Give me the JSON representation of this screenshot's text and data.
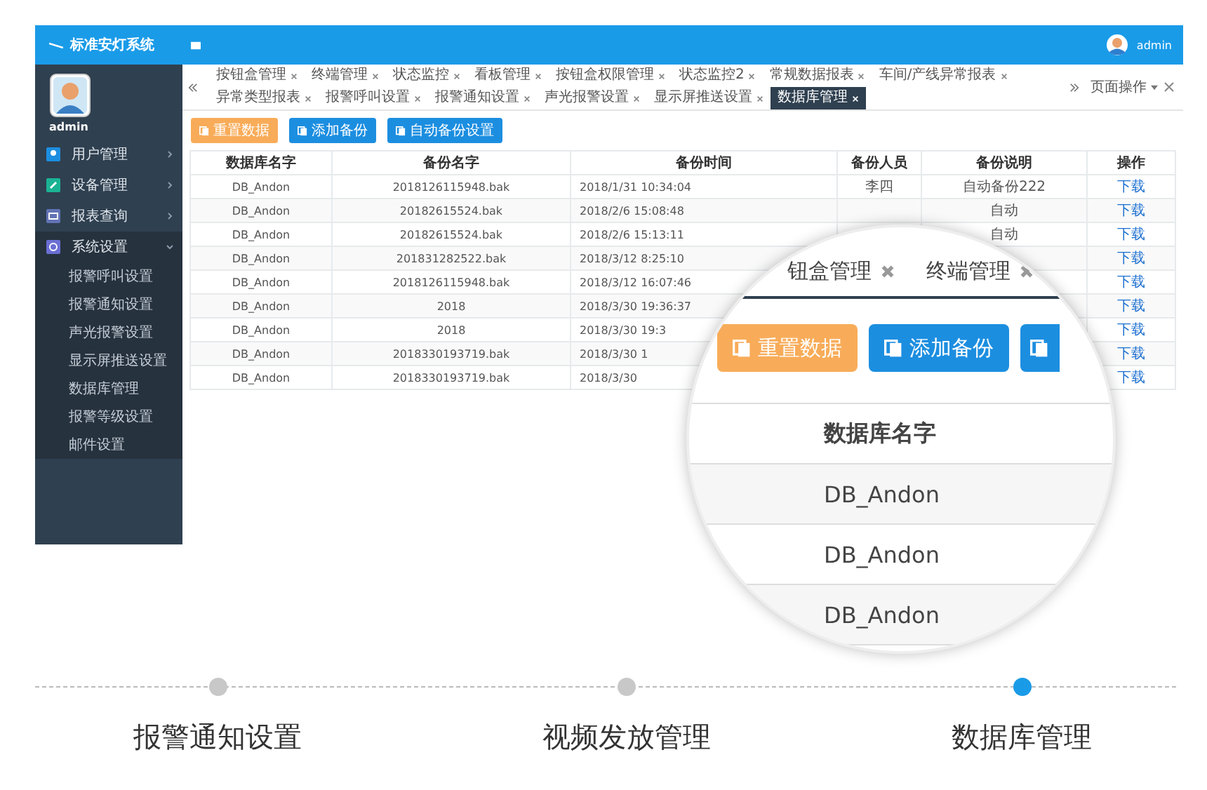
{
  "app": {
    "title": "标准安灯系统",
    "user": "admin",
    "sidebar": {
      "user": "admin",
      "items": [
        {
          "label": "用户管理",
          "expanded": false
        },
        {
          "label": "设备管理",
          "expanded": false
        },
        {
          "label": "报表查询",
          "expanded": false
        },
        {
          "label": "系统设置",
          "expanded": true,
          "children": [
            {
              "label": "报警呼叫设置"
            },
            {
              "label": "报警通知设置"
            },
            {
              "label": "声光报警设置"
            },
            {
              "label": "显示屏推送设置"
            },
            {
              "label": "数据库管理"
            },
            {
              "label": "报警等级设置"
            },
            {
              "label": "邮件设置"
            }
          ]
        }
      ]
    },
    "tabs": [
      {
        "label": "按钮盒管理",
        "selected": false
      },
      {
        "label": "终端管理",
        "selected": false
      },
      {
        "label": "状态监控",
        "selected": false
      },
      {
        "label": "看板管理",
        "selected": false
      },
      {
        "label": "按钮盒权限管理",
        "selected": false
      },
      {
        "label": "状态监控2",
        "selected": false
      },
      {
        "label": "常规数据报表",
        "selected": false
      },
      {
        "label": "车间/产线异常报表",
        "selected": false
      },
      {
        "label": "异常类型报表",
        "selected": false
      },
      {
        "label": "报警呼叫设置",
        "selected": false
      },
      {
        "label": "报警通知设置",
        "selected": false
      },
      {
        "label": "声光报警设置",
        "selected": false
      },
      {
        "label": "显示屏推送设置",
        "selected": false
      },
      {
        "label": "数据库管理",
        "selected": true
      }
    ],
    "tab_menu": "页面操作",
    "buttons": [
      {
        "label": "重置数据",
        "kind": "warning"
      },
      {
        "label": "添加备份",
        "kind": "primary"
      },
      {
        "label": "自动备份设置",
        "kind": "primary"
      }
    ],
    "table": {
      "columns": [
        "数据库名字",
        "备份名字",
        "备份时间",
        "备份人员",
        "备份说明",
        "操作"
      ],
      "rows": [
        {
          "db": "DB_Andon",
          "file": "2018126115948.bak",
          "time": "2018/1/31 10:34:04",
          "person": "李四",
          "note": "自动备份222",
          "action": "下载"
        },
        {
          "db": "DB_Andon",
          "file": "20182615524.bak",
          "time": "2018/2/6 15:08:48",
          "note": "自动",
          "action": "下载"
        },
        {
          "db": "DB_Andon",
          "file": "20182615524.bak",
          "time": "2018/2/6 15:13:11",
          "note": "自动",
          "action": "下载"
        },
        {
          "db": "DB_Andon",
          "file": "201831282522.bak",
          "time": "2018/3/12 8:25:10",
          "action": "下载"
        },
        {
          "db": "DB_Andon",
          "file": "2018126115948.bak",
          "time": "2018/3/12 16:07:46",
          "action": "下载"
        },
        {
          "db": "DB_Andon",
          "file": "2018",
          "time": "2018/3/30 19:36:37",
          "action": "下载"
        },
        {
          "db": "DB_Andon",
          "file": "2018",
          "time": "2018/3/30 19:3",
          "action": "下载"
        },
        {
          "db": "DB_Andon",
          "file": "2018330193719.bak",
          "time": "2018/3/30 1",
          "action": "下载"
        },
        {
          "db": "DB_Andon",
          "file": "2018330193719.bak",
          "time": "2018/3/30",
          "action": "下载"
        }
      ]
    }
  },
  "magnifier": {
    "tabs": [
      "钮盒管理",
      "终端管理"
    ],
    "buttons": [
      {
        "label": "重置数据",
        "kind": "warning"
      },
      {
        "label": "添加备份",
        "kind": "primary"
      }
    ],
    "column": "数据库名字",
    "rows": [
      "DB_Andon",
      "DB_Andon",
      "DB_Andon"
    ]
  },
  "steps": [
    {
      "label": "报警通知设置",
      "selected": false
    },
    {
      "label": "视频发放管理",
      "selected": false
    },
    {
      "label": "数据库管理",
      "selected": true
    }
  ]
}
